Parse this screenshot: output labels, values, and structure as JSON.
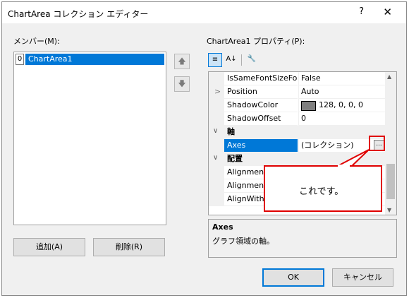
{
  "window": {
    "title": "ChartArea コレクション エディター",
    "help": "?",
    "close": "✕"
  },
  "left": {
    "members_label": "メンバー(M):",
    "items": [
      {
        "index": "0",
        "name": "ChartArea1"
      }
    ],
    "up_arrow": "🡅",
    "down_arrow": "🡇",
    "add_button": "追加(A)",
    "remove_button": "削除(R)"
  },
  "right": {
    "properties_label": "ChartArea1 プロパティ(P):",
    "toolbar": {
      "categorized": "≡",
      "alphabetical": "A↓",
      "pages": "🔧"
    },
    "rows": [
      {
        "name": "IsSameFontSizeForAllAxes",
        "value": "False"
      },
      {
        "expander": ">",
        "name": "Position",
        "value": "Auto"
      },
      {
        "name": "ShadowColor",
        "value": "128, 0, 0, 0"
      },
      {
        "name": "ShadowOffset",
        "value": "0"
      },
      {
        "category": "軸"
      },
      {
        "name": "Axes",
        "value": "(コレクション)",
        "ellipsis": "..."
      },
      {
        "category": "配置"
      },
      {
        "name": "AlignmentOrientation",
        "value": ""
      },
      {
        "name": "AlignmentStyle",
        "value": ""
      },
      {
        "name": "AlignWithChartArea",
        "value": ""
      }
    ],
    "description": {
      "title": "Axes",
      "text": "グラフ領域の軸。"
    }
  },
  "callout": {
    "text": "これです。",
    "border_color": "#e00000"
  },
  "footer": {
    "ok": "OK",
    "cancel": "キャンセル"
  },
  "colors": {
    "accent": "#0078d7",
    "shadow_swatch": "#808080"
  }
}
